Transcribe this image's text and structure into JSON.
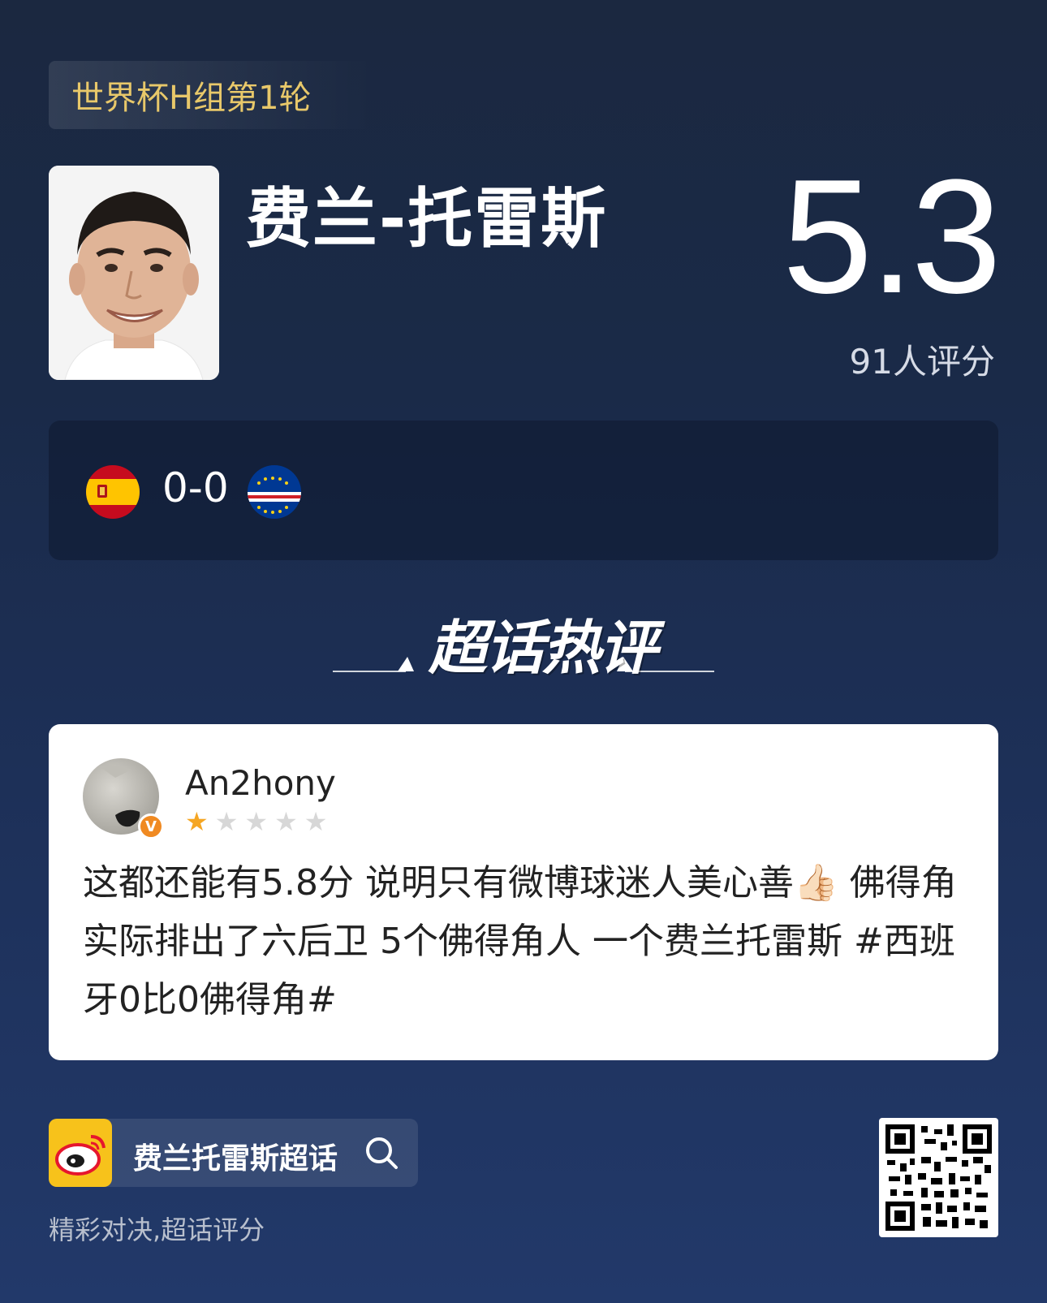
{
  "match_tag": "世界杯H组第1轮",
  "player": {
    "name": "费兰-托雷斯",
    "rating": "5.3",
    "rating_count": "91人评分"
  },
  "match": {
    "home_flag": "spain-flag",
    "away_flag": "cape-verde-flag",
    "score": "0-0"
  },
  "section_title": "超话热评",
  "comment": {
    "username": "An2hony",
    "verified_badge": "V",
    "stars_total": 5,
    "stars_filled": 1,
    "text": "这都还能有5.8分 说明只有微博球迷人美心善👍🏻 佛得角实际排出了六后卫 5个佛得角人 一个费兰托雷斯 #西班牙0比0佛得角#"
  },
  "footer": {
    "topic_label": "费兰托雷斯超话",
    "slogan": "精彩对决,超话评分"
  },
  "colors": {
    "tag_text": "#e8c86a",
    "star_on": "#f5a623",
    "weibo_yellow": "#f7c21b"
  }
}
